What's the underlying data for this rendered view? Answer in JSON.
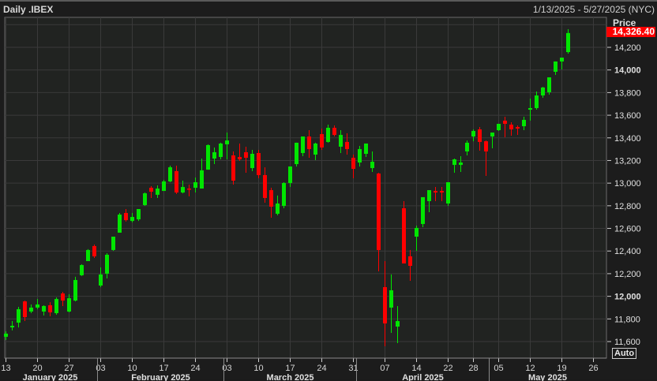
{
  "header": {
    "title": "Daily .IBEX",
    "range": "1/13/2025 - 5/27/2025 (NYC)"
  },
  "price_panel": {
    "heading": "Price",
    "last_price": "14,326.40",
    "auto_label": "Auto"
  },
  "colors": {
    "up": "#00e600",
    "down": "#ff0000",
    "grid": "#3a3a3a",
    "plot_bg": "#212321"
  },
  "chart_data": {
    "type": "candlestick",
    "title": "Daily .IBEX",
    "ylabel": "Price",
    "ylim": [
      11520,
      14400
    ],
    "grid": true,
    "y_ticks": [
      {
        "value": 14200,
        "label": "14,200"
      },
      {
        "value": 14000,
        "label": "14,000",
        "bold": true
      },
      {
        "value": 13800,
        "label": "13,800"
      },
      {
        "value": 13600,
        "label": "13,600"
      },
      {
        "value": 13400,
        "label": "13,400"
      },
      {
        "value": 13200,
        "label": "13,200"
      },
      {
        "value": 13000,
        "label": "13,000"
      },
      {
        "value": 12800,
        "label": "12,800"
      },
      {
        "value": 12600,
        "label": "12,600"
      },
      {
        "value": 12400,
        "label": "12,400"
      },
      {
        "value": 12200,
        "label": "12,200"
      },
      {
        "value": 12000,
        "label": "12,000",
        "bold": true
      },
      {
        "value": 11800,
        "label": "11,800"
      },
      {
        "value": 11600,
        "label": "11,600"
      }
    ],
    "x_ticks": [
      {
        "at": 0,
        "label": "13"
      },
      {
        "at": 5,
        "label": "20"
      },
      {
        "at": 10,
        "label": "27"
      },
      {
        "at": 15,
        "label": "03"
      },
      {
        "at": 20,
        "label": "10"
      },
      {
        "at": 25,
        "label": "17"
      },
      {
        "at": 30,
        "label": "24"
      },
      {
        "at": 35,
        "label": "03"
      },
      {
        "at": 40,
        "label": "10"
      },
      {
        "at": 45,
        "label": "17"
      },
      {
        "at": 50,
        "label": "24"
      },
      {
        "at": 55,
        "label": "31"
      },
      {
        "at": 60,
        "label": "07"
      },
      {
        "at": 65,
        "label": "14"
      },
      {
        "at": 70,
        "label": "22"
      },
      {
        "at": 74,
        "label": "28"
      },
      {
        "at": 78,
        "label": "05"
      },
      {
        "at": 83,
        "label": "12"
      },
      {
        "at": 88,
        "label": "19"
      },
      {
        "at": 93,
        "label": "26"
      }
    ],
    "months": [
      {
        "label": "January 2025",
        "start": -0.5,
        "end": 14.5
      },
      {
        "label": "February 2025",
        "start": 14.5,
        "end": 34.5
      },
      {
        "label": "March 2025",
        "start": 34.5,
        "end": 55.5
      },
      {
        "label": "April 2025",
        "start": 55.5,
        "end": 76.5
      },
      {
        "label": "May 2025",
        "start": 76.5,
        "end": 95
      }
    ],
    "ohlc_columns": [
      "open",
      "high",
      "low",
      "close"
    ],
    "ohlc": [
      [
        11642,
        11691,
        11614,
        11670
      ],
      [
        11725,
        11781,
        11698,
        11739
      ],
      [
        11767,
        11907,
        11725,
        11886
      ],
      [
        11955,
        11962,
        11781,
        11816
      ],
      [
        11865,
        11928,
        11851,
        11900
      ],
      [
        11900,
        11976,
        11886,
        11928
      ],
      [
        11865,
        11921,
        11830,
        11914
      ],
      [
        11921,
        11948,
        11823,
        11858
      ],
      [
        11851,
        11990,
        11837,
        11976
      ],
      [
        12025,
        12039,
        11914,
        11962
      ],
      [
        11865,
        12018,
        11858,
        11983
      ],
      [
        11962,
        12172,
        11955,
        12144
      ],
      [
        12186,
        12283,
        12179,
        12276
      ],
      [
        12311,
        12416,
        12311,
        12409
      ],
      [
        12444,
        12457,
        12339,
        12353
      ],
      [
        12095,
        12255,
        12081,
        12193
      ],
      [
        12200,
        12381,
        12158,
        12367
      ],
      [
        12409,
        12527,
        12402,
        12527
      ],
      [
        12562,
        12736,
        12562,
        12722
      ],
      [
        12736,
        12771,
        12660,
        12673
      ],
      [
        12666,
        12736,
        12653,
        12701
      ],
      [
        12680,
        12771,
        12666,
        12771
      ],
      [
        12806,
        12917,
        12799,
        12910
      ],
      [
        12959,
        12973,
        12869,
        12924
      ],
      [
        12897,
        12980,
        12869,
        12952
      ],
      [
        12931,
        13029,
        12931,
        13015
      ],
      [
        13015,
        13154,
        13008,
        13140
      ],
      [
        13106,
        13154,
        12904,
        12917
      ],
      [
        12917,
        13022,
        12910,
        12966
      ],
      [
        12952,
        12987,
        12883,
        12945
      ],
      [
        12959,
        13050,
        12917,
        13008
      ],
      [
        12952,
        13217,
        12952,
        13113
      ],
      [
        13119,
        13343,
        13119,
        13336
      ],
      [
        13217,
        13315,
        13168,
        13273
      ],
      [
        13231,
        13357,
        13210,
        13350
      ],
      [
        13343,
        13447,
        13210,
        13377
      ],
      [
        13245,
        13280,
        12987,
        13022
      ],
      [
        13231,
        13350,
        13196,
        13210
      ],
      [
        13273,
        13322,
        13092,
        13224
      ],
      [
        13133,
        13294,
        13106,
        13259
      ],
      [
        13266,
        13294,
        13043,
        13071
      ],
      [
        13071,
        13140,
        12827,
        12869
      ],
      [
        12938,
        12959,
        12694,
        12792
      ],
      [
        12729,
        12890,
        12715,
        12820
      ],
      [
        12799,
        13008,
        12778,
        13001
      ],
      [
        13001,
        13147,
        12966,
        13147
      ],
      [
        13168,
        13357,
        13147,
        13357
      ],
      [
        13266,
        13412,
        13238,
        13412
      ],
      [
        13412,
        13468,
        13224,
        13301
      ],
      [
        13252,
        13357,
        13203,
        13350
      ],
      [
        13433,
        13482,
        13294,
        13315
      ],
      [
        13364,
        13517,
        13357,
        13489
      ],
      [
        13489,
        13510,
        13412,
        13426
      ],
      [
        13322,
        13468,
        13266,
        13426
      ],
      [
        13364,
        13440,
        13252,
        13301
      ],
      [
        13224,
        13252,
        13043,
        13126
      ],
      [
        13182,
        13329,
        13147,
        13301
      ],
      [
        13259,
        13350,
        13231,
        13350
      ],
      [
        13133,
        13280,
        13099,
        13189
      ],
      [
        13085,
        13092,
        12220,
        12409
      ],
      [
        12081,
        12311,
        11558,
        11760
      ],
      [
        11900,
        12193,
        11677,
        12053
      ],
      [
        11732,
        11914,
        11586,
        11781
      ],
      [
        12778,
        12841,
        12290,
        12290
      ],
      [
        12353,
        12409,
        12137,
        12269
      ],
      [
        12527,
        12625,
        12402,
        12604
      ],
      [
        12639,
        12876,
        12611,
        12876
      ],
      [
        12841,
        12938,
        12743,
        12938
      ],
      [
        12931,
        12966,
        12841,
        12917
      ],
      [
        12931,
        12966,
        12841,
        12917
      ],
      [
        12820,
        13008,
        12799,
        13008
      ],
      [
        13161,
        13217,
        13092,
        13210
      ],
      [
        13161,
        13238,
        13099,
        13182
      ],
      [
        13280,
        13377,
        13245,
        13357
      ],
      [
        13412,
        13475,
        13370,
        13461
      ],
      [
        13475,
        13496,
        13287,
        13364
      ],
      [
        13370,
        13377,
        13064,
        13280
      ],
      [
        13412,
        13447,
        13308,
        13447
      ],
      [
        13468,
        13524,
        13461,
        13524
      ],
      [
        13552,
        13587,
        13405,
        13524
      ],
      [
        13517,
        13538,
        13419,
        13475
      ],
      [
        13496,
        13510,
        13426,
        13482
      ],
      [
        13503,
        13587,
        13468,
        13559
      ],
      [
        13649,
        13747,
        13552,
        13663
      ],
      [
        13663,
        13810,
        13649,
        13775
      ],
      [
        13775,
        13851,
        13754,
        13845
      ],
      [
        13803,
        13935,
        13782,
        13935
      ],
      [
        13984,
        14075,
        13956,
        14075
      ],
      [
        14075,
        14109,
        14005,
        14109
      ],
      [
        14158,
        14360,
        14144,
        14326.4
      ]
    ]
  }
}
